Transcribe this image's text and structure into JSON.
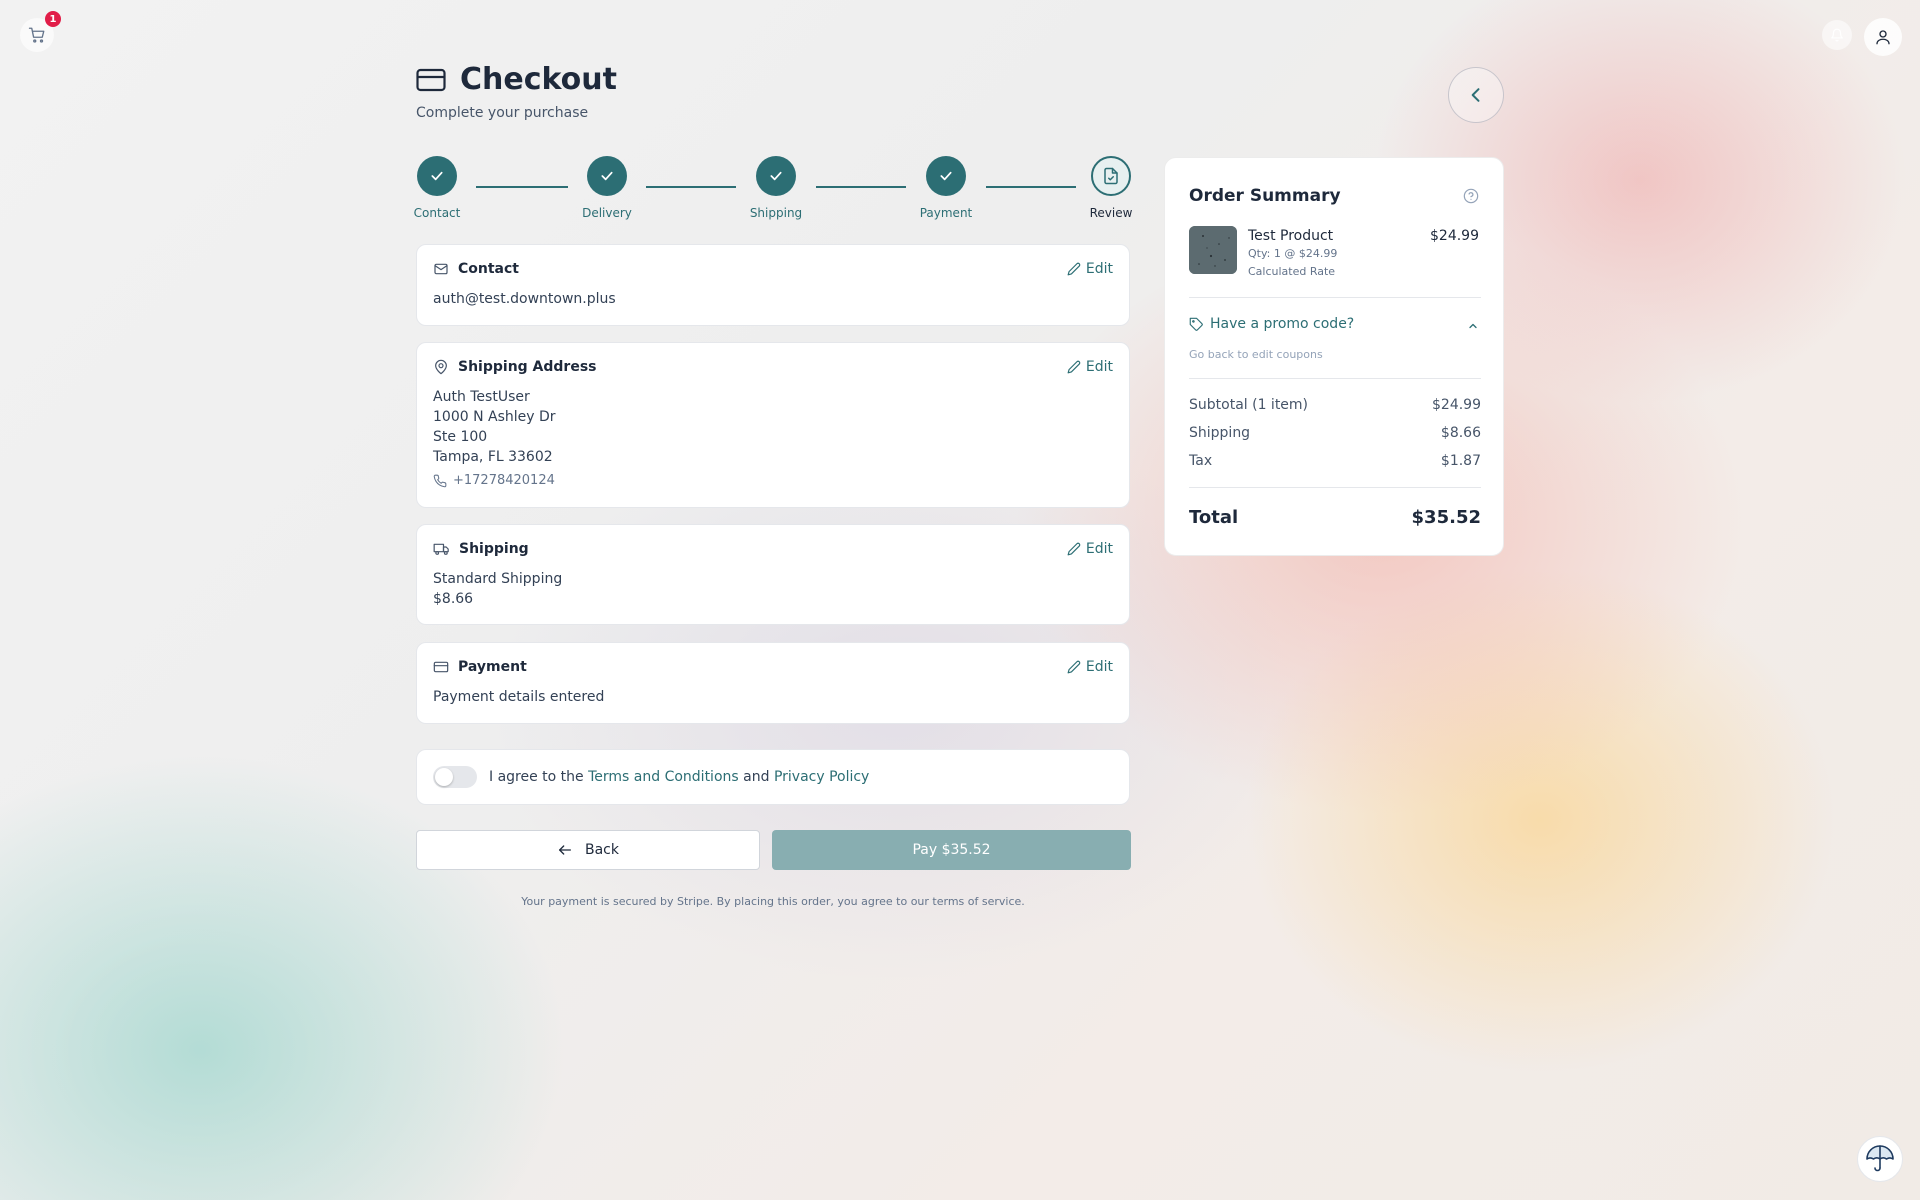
{
  "topbar": {
    "cart_icon": "shopping-cart-icon",
    "cart_count": "1",
    "bell_icon": "bell-icon",
    "user_icon": "user-icon"
  },
  "header": {
    "title": "Checkout",
    "subtitle": "Complete your purchase",
    "icon": "credit-card-icon"
  },
  "stepper": {
    "steps": [
      {
        "label": "Contact",
        "state": "done"
      },
      {
        "label": "Delivery",
        "state": "done"
      },
      {
        "label": "Shipping",
        "state": "done"
      },
      {
        "label": "Payment",
        "state": "done"
      },
      {
        "label": "Review",
        "state": "current"
      }
    ]
  },
  "cards": {
    "edit_label": "Edit",
    "contact": {
      "title": "Contact",
      "email": "auth@test.downtown.plus"
    },
    "address": {
      "title": "Shipping Address",
      "name": "Auth TestUser",
      "line1": "1000 N Ashley Dr",
      "line2": "Ste 100",
      "city": "Tampa, FL 33602",
      "phone": "+17278420124"
    },
    "shipping": {
      "title": "Shipping",
      "method": "Standard Shipping",
      "price": "$8.66"
    },
    "payment": {
      "title": "Payment",
      "status": "Payment details entered"
    }
  },
  "terms": {
    "prefix": "I agree to the",
    "terms_link": "Terms and Conditions",
    "and": "and",
    "privacy_link": "Privacy Policy",
    "agreed": false
  },
  "actions": {
    "back_label": "Back",
    "pay_label": "Pay $35.52"
  },
  "secure_note": "Your payment is secured by Stripe. By placing this order, you agree to our terms of service.",
  "summary": {
    "title": "Order Summary",
    "product": {
      "name": "Test Product",
      "qty": "Qty: 1 @ $24.99",
      "rate": "Calculated Rate",
      "price": "$24.99"
    },
    "promo_label": "Have a promo code?",
    "promo_note": "Go back to edit coupons",
    "rows": [
      {
        "label": "Subtotal (1 item)",
        "value": "$24.99"
      },
      {
        "label": "Shipping",
        "value": "$8.66"
      },
      {
        "label": "Tax",
        "value": "$1.87"
      }
    ],
    "total_label": "Total",
    "total_value": "$35.52"
  },
  "colors": {
    "accent": "#2c6e74",
    "badge": "#e11d48",
    "pay_disabled": "#88aeb1"
  }
}
